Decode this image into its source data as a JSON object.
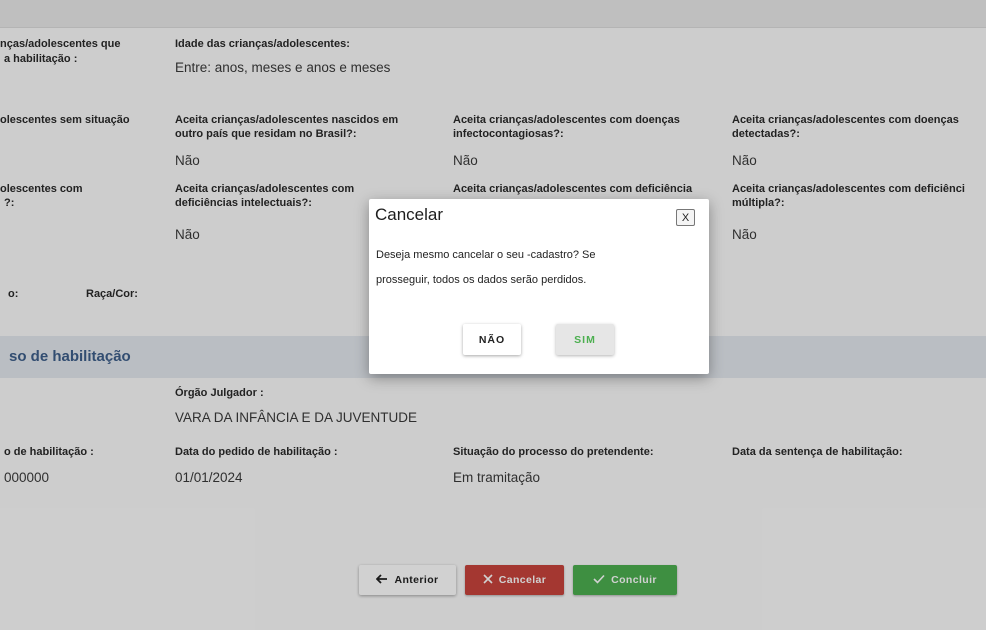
{
  "form": {
    "row1": {
      "col0_label_a": "nças/adolescentes que",
      "col0_label_b": "a habilitação :",
      "age_label": "Idade das crianças/adolescentes:",
      "age_value": "Entre: anos, meses e anos e meses"
    },
    "row2": {
      "col0_label": "olescentes sem situação",
      "foreign_label_a": "Aceita crianças/adolescentes nascidos em",
      "foreign_label_b": "outro país que residam no Brasil?:",
      "foreign_value": "Não",
      "infectious_label_a": "Aceita crianças/adolescentes com doenças",
      "infectious_label_b": "infectocontagiosas?:",
      "infectious_value": "Não",
      "detected_label_a": "Aceita crianças/adolescentes com doenças",
      "detected_label_b": "detectadas?:",
      "detected_value": "Não"
    },
    "row3": {
      "col0_label_a": "olescentes com",
      "col0_label_b": "?:",
      "intellectual_label_a": "Aceita crianças/adolescentes com",
      "intellectual_label_b": "deficiências intelectuais?:",
      "intellectual_value": "Não",
      "disability_label": "Aceita crianças/adolescentes com deficiência",
      "multiple_label_a": "Aceita crianças/adolescentes com deficiênci",
      "multiple_label_b": "múltipla?:",
      "multiple_value": "Não"
    },
    "row4": {
      "col0_label_a": "o:",
      "race_label": "Raça/Cor:"
    }
  },
  "section": {
    "title": "so de habilitação",
    "court_label": "Órgão Julgador :",
    "court_value": "VARA DA INFÂNCIA E DA JUVENTUDE",
    "process_label": "o de habilitação :",
    "process_value": "000000",
    "request_date_label": "Data do pedido de habilitação :",
    "request_date_value": "01/01/2024",
    "status_label": "Situação do processo do pretendente:",
    "status_value": "Em tramitação",
    "sentence_label": "Data da sentença de habilitação:"
  },
  "actions": {
    "previous_label": "Anterior",
    "cancel_label": "Cancelar",
    "conclude_label": "Concluir"
  },
  "dialog": {
    "title": "Cancelar",
    "close_label": "X",
    "message_line1": "Deseja mesmo cancelar o seu     -cadastro? Se",
    "message_line2": "prosseguir, todos os dados serão perdidos.",
    "no_label": "NÃO",
    "yes_label": "SIM"
  },
  "colors": {
    "section_title": "#3e5f8a",
    "cancel_button": "#c9443c",
    "conclude_button": "#4caf50"
  },
  "icons": {
    "previous": "arrow-left-icon",
    "cancel": "x-icon",
    "conclude": "check-icon"
  }
}
